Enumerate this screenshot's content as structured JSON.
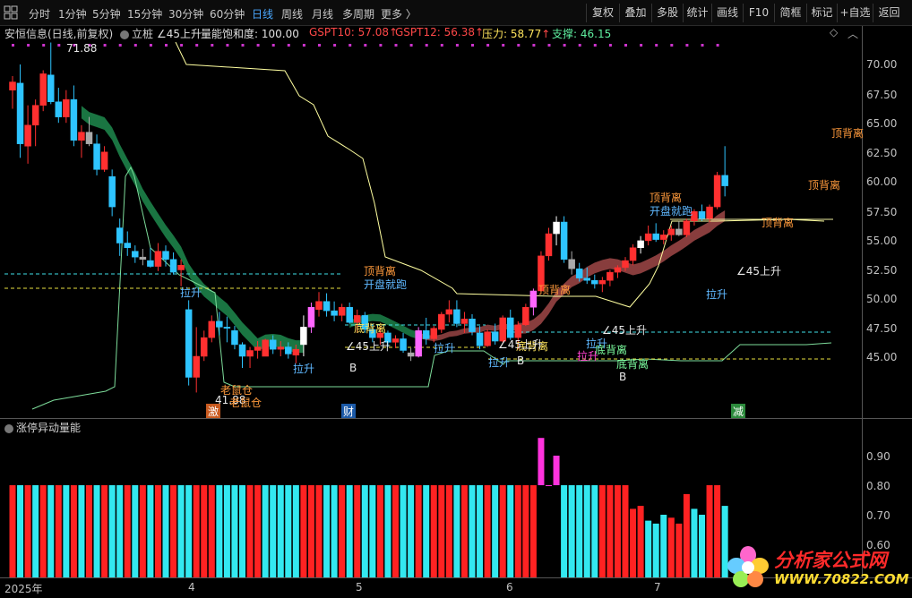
{
  "toolbar": {
    "timeframes": [
      "分时",
      "1分钟",
      "5分钟",
      "15分钟",
      "30分钟",
      "60分钟",
      "日线",
      "周线",
      "月线",
      "多周期",
      "更多 〉"
    ],
    "active_timeframe": "日线",
    "right_buttons": [
      "复权",
      "叠加",
      "多股",
      "统计",
      "画线",
      "F10",
      "简框",
      "标记",
      "+自选",
      "返回"
    ]
  },
  "info": {
    "stock": "安恒信息(日线,前复权)",
    "indicator_name": "立桩",
    "ind1": "∠45上升",
    "ind2": "量能饱和度: 100.00",
    "gspt10": "GSPT10: 57.08",
    "gspt12": "GSPT12: 56.38",
    "pressure": "压力: 58.77",
    "support": "支撑: 46.15",
    "arrow_up": "↑"
  },
  "price_axis": {
    "ticks": [
      "70.00",
      "67.50",
      "65.00",
      "62.50",
      "60.00",
      "57.50",
      "55.00",
      "52.50",
      "50.00",
      "47.50",
      "45.00"
    ],
    "range": [
      42.0,
      73.0
    ]
  },
  "sub_indicator": {
    "name": "涨停异动量能",
    "ticks": [
      "0.90",
      "0.80",
      "0.70",
      "0.60"
    ],
    "range": [
      0.58,
      0.97
    ]
  },
  "x_axis": {
    "labels": [
      "2025年",
      "4",
      "5",
      "6",
      "7"
    ]
  },
  "annotations": {
    "high_price": "71.88",
    "low_price": "41.88",
    "top_divergence": "顶背离",
    "bottom_divergence": "底背离",
    "open_run": "开盘就跑",
    "pull_up": "拉升",
    "rise45": "∠45上升",
    "old_stock_warehouse": "老鼠仓",
    "label_b": "B",
    "event_ji": "激",
    "event_cai": "财",
    "event_jian": "减"
  },
  "watermark": {
    "line1": "分析家公式网",
    "line2": "WWW.70822.COM"
  },
  "colors": {
    "up": "#ff3030",
    "down": "#2ec4ff",
    "band_green": "#1e8a4e",
    "band_red": "#a04848",
    "support_line": "#7ddc9a",
    "resist_line": "#ffffa0",
    "cyan_dash": "#40e0e8",
    "yellow_dash": "#e8e040",
    "magenta": "#ff30e0"
  },
  "chart_data": {
    "type": "candlestick",
    "title": "",
    "y_range": [
      42.0,
      73.0
    ],
    "candles": [
      [
        67.8,
        69.0,
        66.2,
        68.5
      ],
      [
        68.4,
        70.0,
        62.0,
        63.2
      ],
      [
        63.0,
        66.5,
        61.5,
        64.8
      ],
      [
        64.8,
        67.0,
        63.0,
        66.5
      ],
      [
        66.5,
        69.5,
        66.0,
        69.2
      ],
      [
        69.1,
        71.88,
        66.6,
        66.8
      ],
      [
        66.8,
        68.0,
        65.0,
        65.5
      ],
      [
        65.5,
        67.8,
        65.0,
        67.0
      ],
      [
        67.0,
        68.2,
        63.0,
        63.5
      ],
      [
        63.5,
        64.8,
        62.0,
        64.2
      ],
      [
        64.2,
        65.5,
        63.0,
        63.2
      ],
      [
        63.2,
        64.0,
        60.5,
        61.0
      ],
      [
        61.0,
        63.0,
        60.8,
        62.5
      ],
      [
        60.4,
        61.0,
        57.0,
        57.8
      ],
      [
        56.0,
        56.8,
        53.6,
        54.7
      ],
      [
        54.7,
        55.7,
        53.6,
        54.3
      ],
      [
        54.0,
        54.5,
        53.0,
        53.5
      ],
      [
        53.5,
        54.2,
        52.8,
        53.3
      ],
      [
        53.2,
        54.3,
        52.6,
        52.7
      ],
      [
        52.7,
        54.7,
        52.3,
        54.0
      ],
      [
        54.0,
        54.5,
        52.7,
        53.3
      ],
      [
        53.3,
        53.9,
        52.0,
        52.2
      ],
      [
        52.4,
        53.3,
        51.0,
        52.8
      ],
      [
        49.0,
        49.8,
        42.5,
        43.2
      ],
      [
        43.2,
        47.5,
        41.9,
        45.0
      ],
      [
        45.0,
        47.2,
        44.6,
        46.6
      ],
      [
        46.6,
        48.5,
        46.2,
        48.0
      ],
      [
        48.0,
        48.8,
        46.8,
        47.5
      ],
      [
        47.5,
        48.4,
        46.2,
        47.4
      ],
      [
        47.2,
        47.6,
        45.6,
        46.0
      ],
      [
        46.0,
        46.2,
        44.0,
        45.0
      ],
      [
        45.0,
        45.8,
        44.0,
        45.5
      ],
      [
        45.5,
        46.3,
        44.8,
        45.8
      ],
      [
        45.0,
        46.5,
        45.0,
        46.4
      ],
      [
        46.4,
        46.8,
        45.2,
        45.6
      ],
      [
        45.6,
        46.3,
        45.0,
        45.8
      ],
      [
        45.8,
        46.2,
        44.8,
        45.2
      ],
      [
        45.1,
        46.0,
        44.4,
        45.6
      ],
      [
        46.0,
        48.5,
        45.0,
        47.5
      ],
      [
        47.5,
        49.6,
        47.0,
        49.2
      ],
      [
        49.0,
        50.5,
        48.4,
        49.7
      ],
      [
        49.7,
        50.4,
        48.4,
        48.9
      ],
      [
        48.9,
        49.7,
        48.0,
        48.5
      ],
      [
        48.5,
        49.5,
        48.0,
        49.2
      ],
      [
        49.2,
        49.6,
        47.8,
        47.9
      ],
      [
        47.9,
        49.0,
        47.0,
        48.5
      ],
      [
        48.5,
        48.8,
        47.0,
        47.3
      ],
      [
        47.3,
        47.8,
        46.2,
        46.6
      ],
      [
        46.6,
        47.5,
        46.0,
        47.0
      ],
      [
        47.0,
        47.2,
        45.8,
        46.2
      ],
      [
        46.2,
        46.8,
        45.7,
        46.5
      ],
      [
        46.5,
        47.0,
        45.3,
        45.5
      ],
      [
        45.3,
        45.7,
        44.6,
        45.0
      ],
      [
        45.0,
        47.5,
        44.9,
        47.2
      ],
      [
        47.2,
        48.3,
        46.0,
        46.5
      ],
      [
        46.5,
        47.6,
        46.2,
        47.4
      ],
      [
        47.3,
        48.8,
        47.0,
        48.6
      ],
      [
        48.6,
        49.8,
        47.9,
        49.0
      ],
      [
        49.0,
        49.8,
        47.5,
        47.8
      ],
      [
        47.8,
        48.8,
        47.0,
        48.2
      ],
      [
        48.2,
        48.6,
        46.8,
        47.1
      ],
      [
        47.0,
        47.6,
        45.6,
        45.9
      ],
      [
        45.9,
        47.3,
        45.8,
        47.1
      ],
      [
        47.1,
        47.8,
        46.0,
        46.3
      ],
      [
        46.3,
        48.5,
        46.2,
        48.3
      ],
      [
        48.3,
        49.0,
        46.4,
        46.6
      ],
      [
        46.6,
        48.0,
        45.6,
        47.7
      ],
      [
        47.7,
        49.5,
        47.6,
        49.2
      ],
      [
        49.2,
        50.8,
        48.5,
        50.6
      ],
      [
        50.6,
        54.0,
        50.5,
        53.6
      ],
      [
        53.6,
        56.0,
        53.2,
        55.5
      ],
      [
        55.5,
        57.0,
        54.5,
        56.5
      ],
      [
        56.5,
        57.0,
        53.0,
        53.3
      ],
      [
        53.3,
        54.0,
        52.0,
        52.5
      ],
      [
        52.5,
        53.0,
        51.4,
        51.7
      ],
      [
        51.7,
        52.6,
        51.2,
        51.5
      ],
      [
        51.5,
        52.0,
        50.8,
        51.2
      ],
      [
        51.2,
        51.8,
        50.5,
        51.5
      ],
      [
        51.5,
        52.4,
        51.0,
        52.2
      ],
      [
        52.2,
        52.8,
        51.7,
        52.6
      ],
      [
        52.6,
        53.5,
        52.3,
        53.2
      ],
      [
        53.2,
        54.6,
        52.8,
        54.3
      ],
      [
        54.3,
        55.3,
        53.8,
        54.9
      ],
      [
        54.9,
        56.2,
        54.5,
        55.5
      ],
      [
        55.5,
        56.4,
        54.8,
        55.0
      ],
      [
        55.0,
        55.8,
        54.6,
        55.4
      ],
      [
        55.4,
        56.2,
        54.9,
        55.9
      ],
      [
        55.9,
        56.6,
        55.3,
        55.4
      ],
      [
        55.4,
        56.8,
        55.2,
        56.6
      ],
      [
        56.6,
        57.6,
        56.2,
        57.4
      ],
      [
        57.4,
        58.0,
        56.6,
        56.8
      ],
      [
        56.8,
        58.0,
        56.5,
        57.8
      ],
      [
        57.8,
        60.8,
        57.6,
        60.5
      ],
      [
        60.5,
        63.0,
        58.7,
        59.6
      ]
    ],
    "sub_values": [
      [
        0.8,
        "r"
      ],
      [
        0.8,
        "c"
      ],
      [
        0.8,
        "r"
      ],
      [
        0.8,
        "c"
      ],
      [
        0.8,
        "r"
      ],
      [
        0.8,
        "c"
      ],
      [
        0.8,
        "r"
      ],
      [
        0.8,
        "c"
      ],
      [
        0.8,
        "r"
      ],
      [
        0.8,
        "c"
      ],
      [
        0.8,
        "r"
      ],
      [
        0.8,
        "c"
      ],
      [
        0.8,
        "r"
      ],
      [
        0.8,
        "c"
      ],
      [
        0.8,
        "c"
      ],
      [
        0.8,
        "r"
      ],
      [
        0.8,
        "c"
      ],
      [
        0.8,
        "r"
      ],
      [
        0.8,
        "c"
      ],
      [
        0.8,
        "r"
      ],
      [
        0.8,
        "c"
      ],
      [
        0.8,
        "r"
      ],
      [
        0.8,
        "c"
      ],
      [
        0.8,
        "c"
      ],
      [
        0.8,
        "r"
      ],
      [
        0.8,
        "r"
      ],
      [
        0.8,
        "r"
      ],
      [
        0.8,
        "c"
      ],
      [
        0.8,
        "c"
      ],
      [
        0.8,
        "c"
      ],
      [
        0.8,
        "c"
      ],
      [
        0.8,
        "r"
      ],
      [
        0.8,
        "r"
      ],
      [
        0.8,
        "c"
      ],
      [
        0.8,
        "c"
      ],
      [
        0.8,
        "c"
      ],
      [
        0.8,
        "c"
      ],
      [
        0.8,
        "c"
      ],
      [
        0.8,
        "r"
      ],
      [
        0.8,
        "r"
      ],
      [
        0.8,
        "r"
      ],
      [
        0.8,
        "c"
      ],
      [
        0.8,
        "c"
      ],
      [
        0.8,
        "r"
      ],
      [
        0.8,
        "c"
      ],
      [
        0.8,
        "r"
      ],
      [
        0.8,
        "c"
      ],
      [
        0.8,
        "c"
      ],
      [
        0.8,
        "r"
      ],
      [
        0.8,
        "c"
      ],
      [
        0.8,
        "r"
      ],
      [
        0.8,
        "c"
      ],
      [
        0.8,
        "c"
      ],
      [
        0.8,
        "r"
      ],
      [
        0.8,
        "c"
      ],
      [
        0.8,
        "r"
      ],
      [
        0.8,
        "r"
      ],
      [
        0.8,
        "r"
      ],
      [
        0.8,
        "c"
      ],
      [
        0.8,
        "r"
      ],
      [
        0.8,
        "c"
      ],
      [
        0.8,
        "c"
      ],
      [
        0.8,
        "r"
      ],
      [
        0.8,
        "c"
      ],
      [
        0.8,
        "r"
      ],
      [
        0.8,
        "c"
      ],
      [
        0.8,
        "r"
      ],
      [
        0.8,
        "r"
      ],
      [
        0.8,
        "r"
      ],
      [
        0.96,
        "m"
      ],
      [
        0.8,
        "m"
      ],
      [
        0.9,
        "m"
      ],
      [
        0.8,
        "c"
      ],
      [
        0.8,
        "c"
      ],
      [
        0.8,
        "c"
      ],
      [
        0.8,
        "c"
      ],
      [
        0.8,
        "c"
      ],
      [
        0.8,
        "r"
      ],
      [
        0.8,
        "r"
      ],
      [
        0.8,
        "r"
      ],
      [
        0.8,
        "r"
      ],
      [
        0.72,
        "r"
      ],
      [
        0.73,
        "r"
      ],
      [
        0.68,
        "c"
      ],
      [
        0.67,
        "c"
      ],
      [
        0.7,
        "c"
      ],
      [
        0.69,
        "r"
      ],
      [
        0.67,
        "r"
      ],
      [
        0.77,
        "r"
      ],
      [
        0.72,
        "c"
      ],
      [
        0.7,
        "c"
      ],
      [
        0.8,
        "r"
      ],
      [
        0.8,
        "r"
      ],
      [
        0.73,
        "c"
      ]
    ]
  }
}
